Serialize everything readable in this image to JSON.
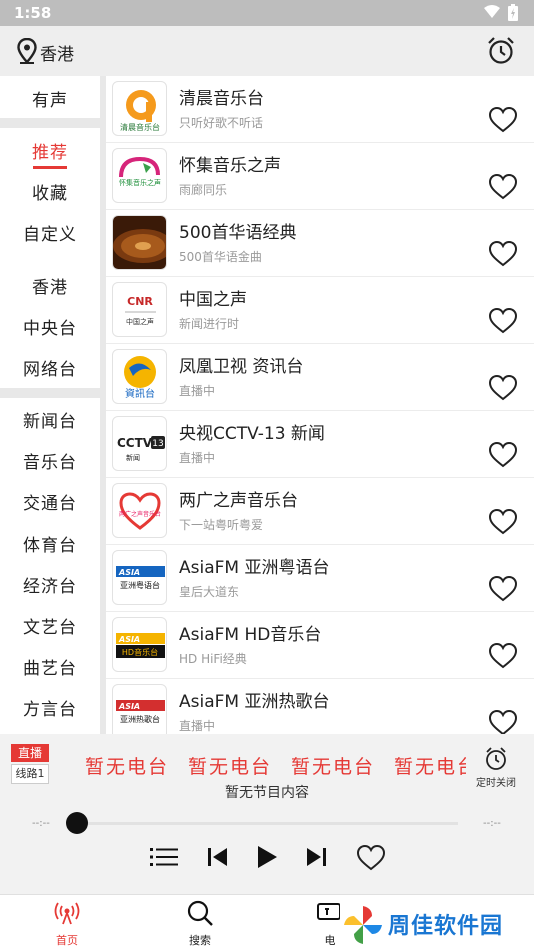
{
  "status_bar": {
    "time": "1:58"
  },
  "header": {
    "location": "香港"
  },
  "sidebar": {
    "items": [
      {
        "label": "有声",
        "active": false
      },
      {
        "label": "推荐",
        "active": true
      },
      {
        "label": "收藏",
        "active": false
      },
      {
        "label": "自定义",
        "active": false
      },
      {
        "label": "香港",
        "active": false
      },
      {
        "label": "中央台",
        "active": false
      },
      {
        "label": "网络台",
        "active": false
      },
      {
        "label": "新闻台",
        "active": false
      },
      {
        "label": "音乐台",
        "active": false
      },
      {
        "label": "交通台",
        "active": false
      },
      {
        "label": "体育台",
        "active": false
      },
      {
        "label": "经济台",
        "active": false
      },
      {
        "label": "文艺台",
        "active": false
      },
      {
        "label": "曲艺台",
        "active": false
      },
      {
        "label": "方言台",
        "active": false
      }
    ]
  },
  "stations": [
    {
      "name": "清晨音乐台",
      "subtitle": "只听好歌不听话",
      "logo_text": "清晨音乐台"
    },
    {
      "name": "怀集音乐之声",
      "subtitle": "雨廊同乐",
      "logo_text": "怀集音乐之声"
    },
    {
      "name": "500首华语经典",
      "subtitle": "500首华语金曲",
      "logo_text": ""
    },
    {
      "name": "中国之声",
      "subtitle": "新闻进行时",
      "logo_text": "CNR",
      "logo_text2": "中国之声"
    },
    {
      "name": "凤凰卫视 资讯台",
      "subtitle": "直播中",
      "logo_text": "資訊台"
    },
    {
      "name": "央视CCTV-13 新闻",
      "subtitle": "直播中",
      "logo_text": "CCTV",
      "logo_text2": "13",
      "logo_text3": "新闻"
    },
    {
      "name": "两广之声音乐台",
      "subtitle": "下一站粤听粤爱",
      "logo_text": "两广之声音乐台"
    },
    {
      "name": "AsiaFM 亚洲粤语台",
      "subtitle": "皇后大道东",
      "logo_text": "ASIA",
      "logo_text2": "亚洲粤语台"
    },
    {
      "name": "AsiaFM HD音乐台",
      "subtitle": "HD HiFi经典",
      "logo_text": "ASIA",
      "logo_text2": "HD音乐台"
    },
    {
      "name": "AsiaFM 亚洲热歌台",
      "subtitle": "直播中",
      "logo_text": "ASIA",
      "logo_text2": "亚洲热歌台"
    }
  ],
  "player": {
    "live_label": "直播",
    "line_label": "线路1",
    "marquee": [
      "暂无电台",
      "暂无电台",
      "暂无电台",
      "暂无电台"
    ],
    "program": "暂无节目内容",
    "timer_label": "定时关闭",
    "time_start": "--:--",
    "time_end": "--:--",
    "progress": 0
  },
  "bottom_nav": {
    "items": [
      {
        "label": "首页",
        "icon": "radio-icon",
        "active": true
      },
      {
        "label": "搜索",
        "icon": "search-icon",
        "active": false
      },
      {
        "label": "电",
        "icon": "tv-icon",
        "active": false
      }
    ]
  },
  "watermark": {
    "text": "周佳软件园"
  },
  "colors": {
    "accent": "#e53935",
    "sidebar_bg": "#e8e8e8",
    "header_bg": "#eeeeee",
    "status_bar": "#bdbdbd",
    "watermark": "#1976d2"
  }
}
